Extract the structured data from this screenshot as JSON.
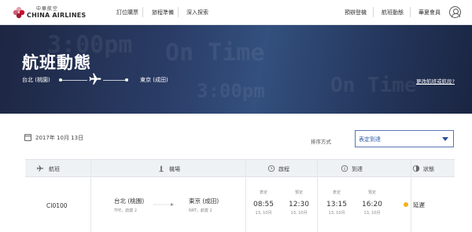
{
  "brand": {
    "name_cn": "中華航空",
    "name_en": "CHINA AIRLINES",
    "accent_color": "#c8102e"
  },
  "nav": {
    "left": [
      "訂位購票",
      "旅程準備",
      "深入探索"
    ],
    "right": [
      "預辦登機",
      "航班動態",
      "華夏會員"
    ],
    "member_icon": "user-circle-icon"
  },
  "hero": {
    "title": "航班動態",
    "from": "台北 (桃園)",
    "to": "東京 (成田)",
    "change_link": "更改航班或航段?",
    "plane_icon": "airplane-icon",
    "decor_texts": [
      "3:00pm",
      "On Time",
      "3:00pm",
      "On Time"
    ]
  },
  "date": {
    "icon": "calendar-icon",
    "text": "2017年 10月 13日"
  },
  "sort": {
    "label": "排序方式",
    "value": "表定到達"
  },
  "table": {
    "headers": [
      {
        "icon": "airplane-icon",
        "label": "航班"
      },
      {
        "icon": "airport-icon",
        "label": "機場"
      },
      {
        "icon": "departure-clock-icon",
        "label": "啟程"
      },
      {
        "icon": "info-icon",
        "label": "到達"
      },
      {
        "icon": "status-icon",
        "label": "狀態"
      }
    ],
    "rows": [
      {
        "flight": "CI0100",
        "origin": {
          "name": "台北 (桃園)",
          "detail": "TPE，航廈 2"
        },
        "destination": {
          "name": "東京 (成田)",
          "detail": "NRT，航廈 2"
        },
        "departure": {
          "scheduled_label": "表定",
          "scheduled_time": "08:55",
          "scheduled_date": "13, 10月",
          "estimated_label": "預定",
          "estimated_time": "12:30",
          "estimated_date": "13, 10月"
        },
        "arrival": {
          "scheduled_label": "表定",
          "scheduled_time": "13:15",
          "scheduled_date": "13, 10月",
          "estimated_label": "預定",
          "estimated_time": "16:20",
          "estimated_date": "13, 10月"
        },
        "status": "延遲",
        "status_color": "#f2b21b"
      }
    ]
  }
}
